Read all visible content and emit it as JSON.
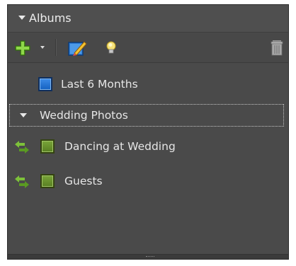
{
  "panel": {
    "title": "Albums"
  },
  "toolbar": {
    "buttons": [
      {
        "name": "add-album-button",
        "icon": "plus-icon"
      },
      {
        "name": "add-dropdown-button",
        "icon": "chevron-down-icon"
      },
      {
        "name": "edit-album-button",
        "icon": "edit-icon"
      },
      {
        "name": "smart-album-button",
        "icon": "lightbulb-icon"
      },
      {
        "name": "delete-album-button",
        "icon": "trash-icon"
      }
    ]
  },
  "albums": {
    "last6": {
      "label": "Last 6 Months",
      "icon": "smart-album-icon",
      "color": "#1a6fd6"
    },
    "group": {
      "label": "Wedding Photos",
      "expanded": true
    },
    "dancing": {
      "label": "Dancing at Wedding",
      "icon": "album-icon",
      "color": "#6a9330",
      "sync_icon": "sync-arrows-icon"
    },
    "guests": {
      "label": "Guests",
      "icon": "album-icon",
      "color": "#6a9330",
      "sync_icon": "sync-arrows-icon"
    }
  },
  "colors": {
    "panel_bg": "#4a4a4a",
    "header_bg": "#4f4f4f",
    "text": "#e6e6e6",
    "accent_green": "#7dc13a"
  }
}
